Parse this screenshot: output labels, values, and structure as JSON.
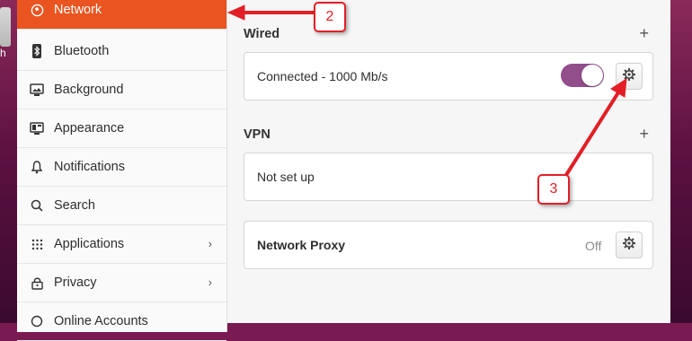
{
  "desktop": {
    "dock_label": "h"
  },
  "sidebar": {
    "items": [
      {
        "label": "Network",
        "icon": "network-icon",
        "active": true
      },
      {
        "label": "Bluetooth",
        "icon": "bluetooth-icon"
      },
      {
        "label": "Background",
        "icon": "background-icon"
      },
      {
        "label": "Appearance",
        "icon": "appearance-icon"
      },
      {
        "label": "Notifications",
        "icon": "bell-icon"
      },
      {
        "label": "Search",
        "icon": "search-icon"
      },
      {
        "label": "Applications",
        "icon": "apps-grid-icon",
        "chevron": "›"
      },
      {
        "label": "Privacy",
        "icon": "lock-icon",
        "chevron": "›"
      },
      {
        "label": "Online Accounts",
        "icon": "accounts-icon"
      }
    ]
  },
  "main": {
    "wired": {
      "title": "Wired",
      "add": "+",
      "status": "Connected - 1000 Mb/s",
      "toggle_on": true
    },
    "vpn": {
      "title": "VPN",
      "add": "+",
      "status": "Not set up"
    },
    "proxy": {
      "title": "Network Proxy",
      "state": "Off"
    }
  },
  "annotations": [
    {
      "number": "2"
    },
    {
      "number": "3"
    }
  ],
  "colors": {
    "accent": "#e95420",
    "toggle": "#924d8b",
    "annotation": "#e21f26"
  }
}
